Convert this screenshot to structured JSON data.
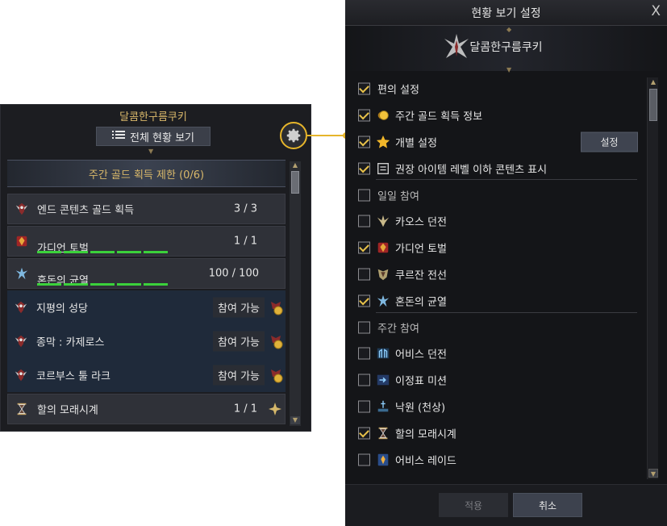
{
  "left_panel": {
    "character_name": "달콤한구름쿠키",
    "view_all_label": "전체 현황 보기",
    "weekly_gold_limit": "주간 골드 획득 제한 (0/6)",
    "rows": [
      {
        "name": "엔드 콘텐츠 골드 획득",
        "value": "3  /  3",
        "icon": "demon-crest-icon"
      },
      {
        "name": "가디언 토벌",
        "value": "1  /  1",
        "icon": "guardian-icon",
        "progress_bars": 5
      },
      {
        "name": "혼돈의 균열",
        "value": "100 / 100",
        "icon": "chaos-rift-icon",
        "progress_bars": 5
      },
      {
        "name": "지평의 성당",
        "status": "참여 가능",
        "icon": "demon-crest-icon"
      },
      {
        "name": "종막 : 카제로스",
        "status": "참여 가능",
        "icon": "demon-crest-icon"
      },
      {
        "name": "코르부스 툴 라크",
        "status": "참여 가능",
        "icon": "demon-crest-icon"
      },
      {
        "name": "할의 모래시계",
        "value": "1  /  1",
        "icon": "hourglass-icon"
      }
    ]
  },
  "settings_dialog": {
    "title": "현황 보기 설정",
    "close_label": "X",
    "character_name": "달콤한구름쿠키",
    "settings_button": "설정",
    "items": [
      {
        "label": "편의 설정",
        "checked": true,
        "section": true
      },
      {
        "label": "주간 골드 획득 정보",
        "checked": true,
        "icon": "gold-coin-icon"
      },
      {
        "label": "개별 설정",
        "checked": true,
        "icon": "star-icon",
        "has_button": true
      },
      {
        "label": "권장 아이템 레벨 이하 콘텐츠 표시",
        "checked": true,
        "icon": "list-icon"
      },
      {
        "label": "일일 참여",
        "checked": false,
        "section": true
      },
      {
        "label": "카오스 던전",
        "checked": false,
        "icon": "chaos-dungeon-icon"
      },
      {
        "label": "가디언 토벌",
        "checked": true,
        "icon": "guardian-icon"
      },
      {
        "label": "쿠르잔 전선",
        "checked": false,
        "icon": "kurzan-front-icon"
      },
      {
        "label": "혼돈의 균열",
        "checked": true,
        "icon": "chaos-rift-icon"
      },
      {
        "label": "주간 참여",
        "checked": false,
        "section": true
      },
      {
        "label": "어비스 던전",
        "checked": false,
        "icon": "abyss-dungeon-icon"
      },
      {
        "label": "이정표 미션",
        "checked": false,
        "icon": "milestone-icon"
      },
      {
        "label": "낙원 (천상)",
        "checked": false,
        "icon": "paradise-icon"
      },
      {
        "label": "할의 모래시계",
        "checked": true,
        "icon": "hourglass-icon"
      },
      {
        "label": "어비스 레이드",
        "checked": false,
        "icon": "abyss-raid-icon"
      }
    ],
    "apply_label": "적용",
    "cancel_label": "취소"
  },
  "colors": {
    "gold": "#d9b86a",
    "highlight": "#e6b52b",
    "progress_green": "#3bd13b",
    "check_gold": "#e8c24a"
  }
}
